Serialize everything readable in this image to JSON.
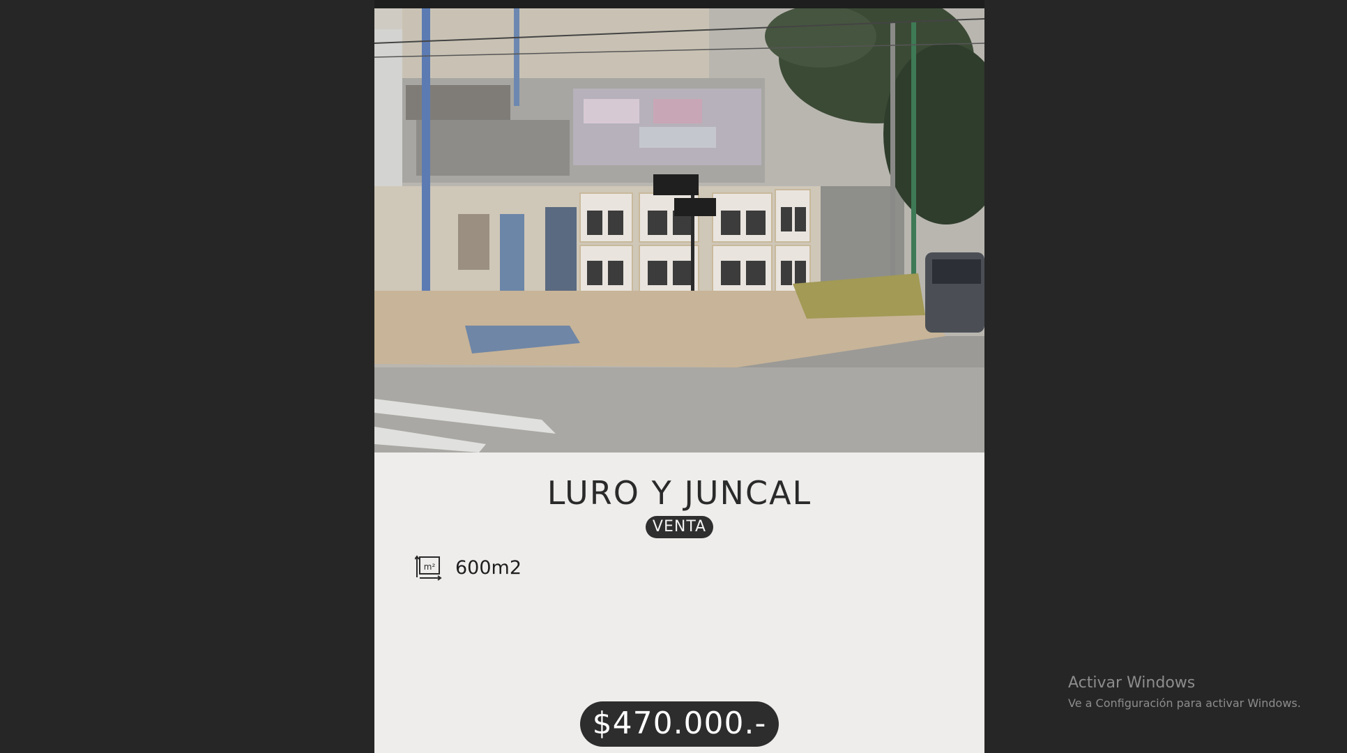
{
  "listing": {
    "title": "LURO Y JUNCAL",
    "operation_badge": "VENTA",
    "area_icon": "area-m2-icon",
    "area_icon_text": "m²",
    "area": "600m2",
    "price": "$470.000.-"
  },
  "watermark": {
    "title": "Activar Windows",
    "subtitle": "Ve a Configuración para activar Windows."
  }
}
